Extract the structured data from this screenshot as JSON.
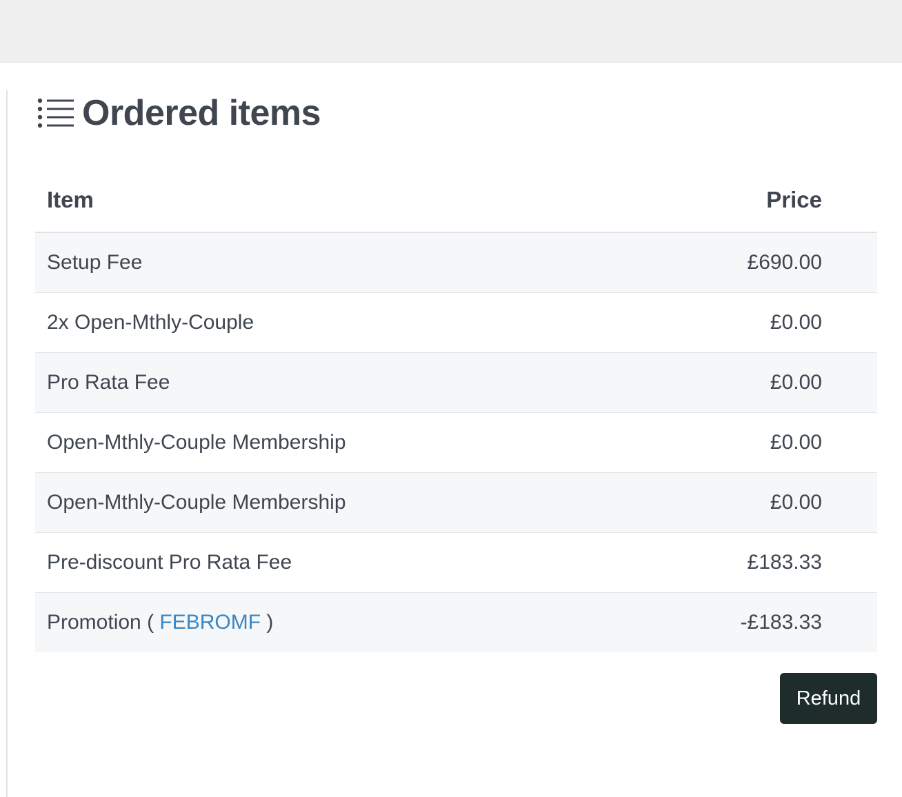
{
  "section": {
    "title": "Ordered items",
    "icon": "list-icon"
  },
  "table": {
    "columns": {
      "item": "Item",
      "price": "Price"
    },
    "rows": [
      {
        "item": "Setup Fee",
        "price": "£690.00"
      },
      {
        "item": "2x Open-Mthly-Couple",
        "price": "£0.00"
      },
      {
        "item": "Pro Rata Fee",
        "price": "£0.00"
      },
      {
        "item": "Open-Mthly-Couple Membership",
        "price": "£0.00"
      },
      {
        "item": "Open-Mthly-Couple Membership",
        "price": "£0.00"
      },
      {
        "item": "Pre-discount Pro Rata Fee",
        "price": "£183.33"
      }
    ],
    "promotion": {
      "prefix": "Promotion (",
      "code": "FEBROMF",
      "suffix": ")",
      "price": "-£183.33"
    }
  },
  "actions": {
    "refund_label": "Refund"
  },
  "colors": {
    "top_bar": "#efefef",
    "text": "#3f4650",
    "link": "#3a86c4",
    "button": "#1e2d2b",
    "row_stripe": "#f6f7f9"
  }
}
